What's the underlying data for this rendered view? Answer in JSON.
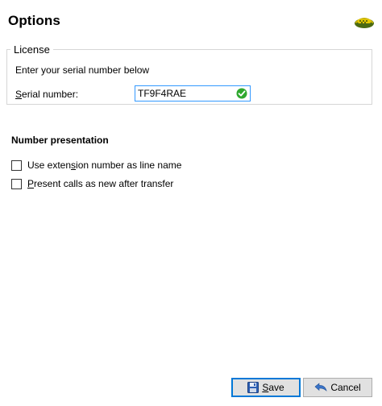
{
  "header": {
    "title": "Options",
    "logo_icon": "phone-logo-icon"
  },
  "license": {
    "legend": "License",
    "instruction": "Enter your serial number below",
    "serial_label_underlined": "S",
    "serial_label_rest": "erial number:",
    "serial_value": "TF9F4RAE",
    "valid_icon": "checkmark-circle-icon",
    "valid_color": "#2fa82f"
  },
  "number_presentation": {
    "title": "Number presentation",
    "options": [
      {
        "pre": "Use exten",
        "ul": "s",
        "post": "ion number as line name",
        "checked": false
      },
      {
        "pre": "",
        "ul": "P",
        "post": "resent calls as new after transfer",
        "checked": false
      }
    ]
  },
  "buttons": {
    "save_ul": "S",
    "save_rest": "ave",
    "save_icon": "floppy-disk-icon",
    "cancel_label": "Cancel",
    "cancel_icon": "cancel-arrow-icon"
  },
  "colors": {
    "focus_border": "#3399ff",
    "button_bg": "#e1e1e1",
    "default_button_border": "#0078d7"
  }
}
